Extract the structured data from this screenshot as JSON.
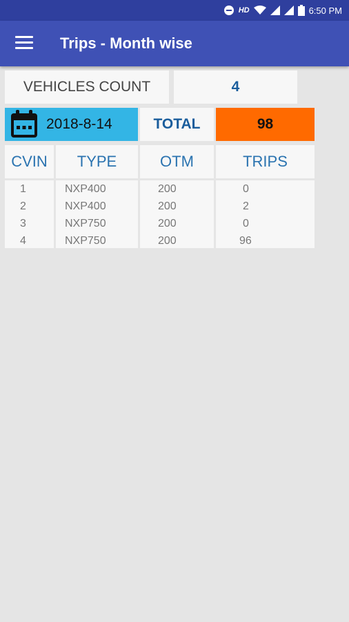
{
  "status_bar": {
    "hd": "HD",
    "time": "6:50 PM"
  },
  "toolbar": {
    "title": "Trips - Month wise"
  },
  "summary": {
    "vehicles_count_label": "VEHICLES COUNT",
    "vehicles_count_value": "4",
    "date": "2018-8-14",
    "total_label": "TOTAL",
    "total_value": "98"
  },
  "table": {
    "headers": [
      "CVIN",
      "TYPE",
      "OTM",
      "TRIPS"
    ],
    "rows": [
      [
        "1",
        "NXP400",
        "200",
        "0"
      ],
      [
        "2",
        "NXP400",
        "200",
        "2"
      ],
      [
        "3",
        "NXP750",
        "200",
        "0"
      ],
      [
        "4",
        "NXP750",
        "200",
        "96"
      ]
    ]
  },
  "colors": {
    "app_bar": "#3f51b5",
    "status_bar": "#2f3f9e",
    "date_bg": "#33b5e5",
    "total_bg": "#ff6a00",
    "accent_text": "#1a5d9c"
  },
  "icons": [
    "dnd-icon",
    "wifi-icon",
    "signal-icon",
    "signal-icon-2",
    "battery-icon",
    "menu-icon",
    "calendar-icon"
  ]
}
